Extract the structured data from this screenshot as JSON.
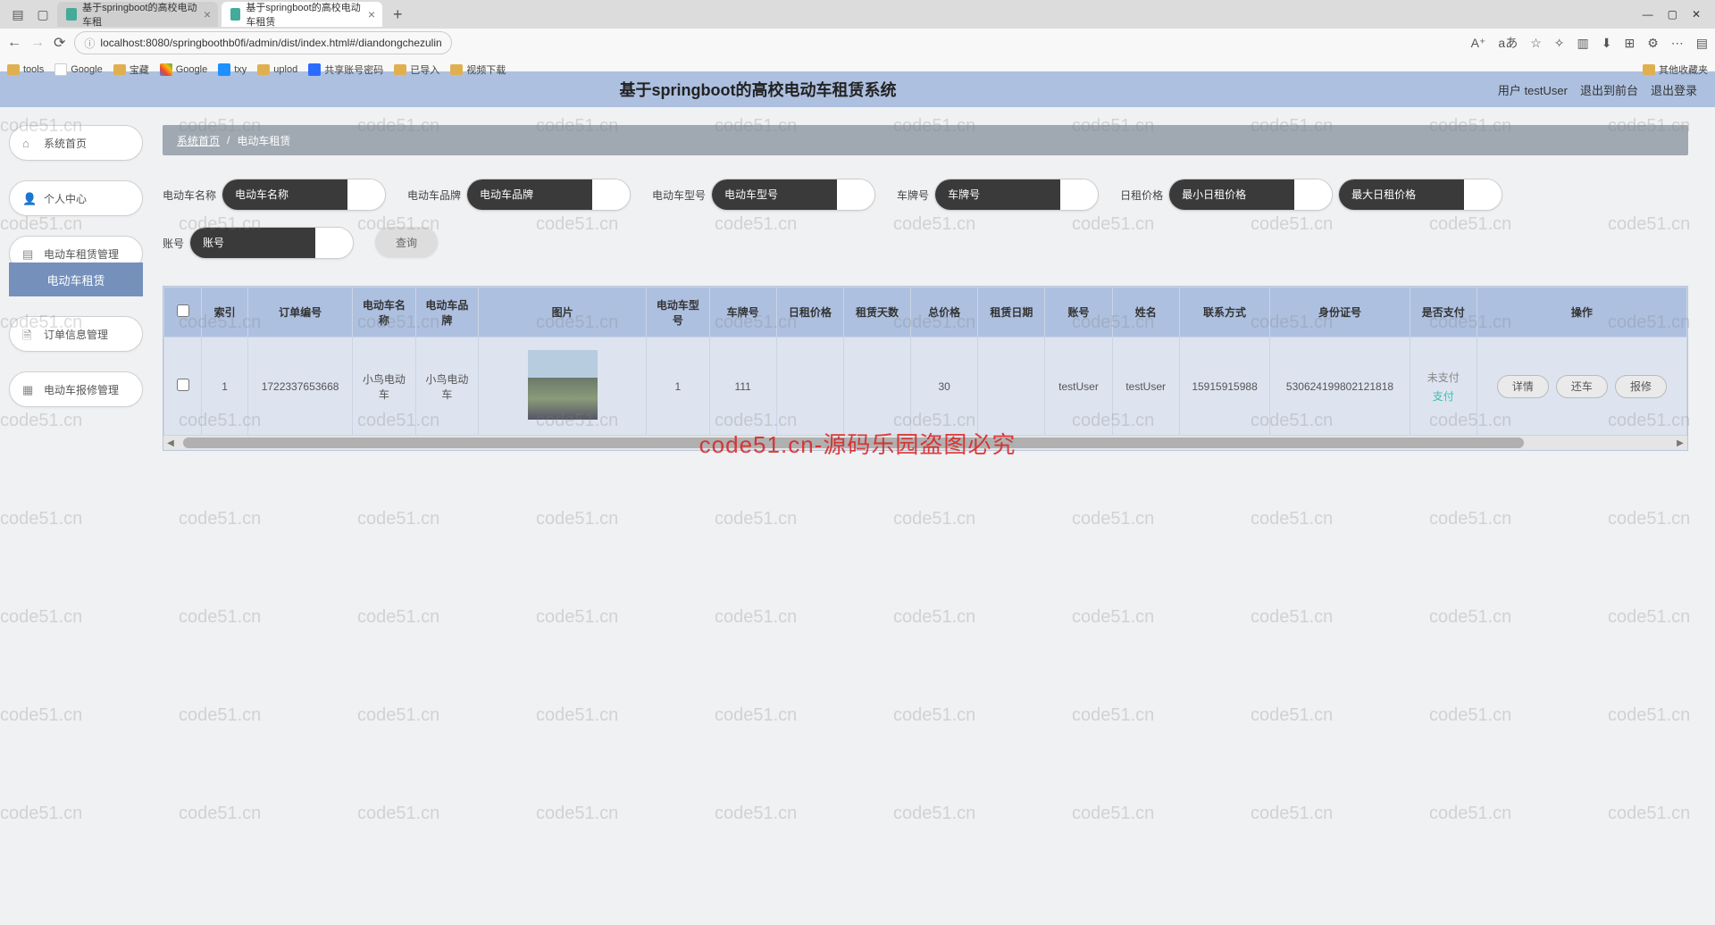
{
  "browser": {
    "tabs": [
      {
        "title": "基于springboot的高校电动车租",
        "active": false
      },
      {
        "title": "基于springboot的高校电动车租赁",
        "active": true
      }
    ],
    "url": "localhost:8080/springboothb0fi/admin/dist/index.html#/diandongchezulin",
    "bookmarks": [
      "tools",
      "Google",
      "宝藏",
      "Google",
      "txy",
      "uplod",
      "共享账号密码",
      "已导入",
      "视频下载"
    ],
    "other_bookmarks": "其他收藏夹"
  },
  "header": {
    "title": "基于springboot的高校电动车租赁系统",
    "user_label": "用户",
    "username": "testUser",
    "to_front": "退出到前台",
    "logout": "退出登录"
  },
  "sidebar": {
    "items": [
      {
        "label": "系统首页",
        "icon": "home"
      },
      {
        "label": "个人中心",
        "icon": "user"
      },
      {
        "label": "电动车租赁管理",
        "icon": "list",
        "sub": "电动车租赁"
      },
      {
        "label": "订单信息管理",
        "icon": "doc"
      },
      {
        "label": "电动车报修管理",
        "icon": "grid"
      }
    ]
  },
  "breadcrumb": {
    "home": "系统首页",
    "sep": "/",
    "current": "电动车租赁"
  },
  "filters": {
    "name_label": "电动车名称",
    "name_ph": "电动车名称",
    "brand_label": "电动车品牌",
    "brand_ph": "电动车品牌",
    "model_label": "电动车型号",
    "model_ph": "电动车型号",
    "plate_label": "车牌号",
    "plate_ph": "车牌号",
    "dayprice_label": "日租价格",
    "min_ph": "最小日租价格",
    "max_ph": "最大日租价格",
    "acct_label": "账号",
    "acct_ph": "账号",
    "query": "查询"
  },
  "table": {
    "headers": [
      "索引",
      "订单编号",
      "电动车名称",
      "电动车品牌",
      "图片",
      "电动车型号",
      "车牌号",
      "日租价格",
      "租赁天数",
      "总价格",
      "租赁日期",
      "账号",
      "姓名",
      "联系方式",
      "身份证号",
      "是否支付",
      "操作"
    ],
    "rows": [
      {
        "idx": "1",
        "order_no": "1722337653668",
        "name": "小鸟电动车",
        "brand": "小鸟电动车",
        "model": "1",
        "plate": "111",
        "day_price": "",
        "days": "",
        "total": "30",
        "date": "",
        "account": "testUser",
        "uname": "testUser",
        "contact": "15915915988",
        "id_no": "530624199802121818",
        "pay_status": "未支付",
        "pay_action": "支付",
        "ops": {
          "detail": "详情",
          "return": "还车",
          "repair": "报修"
        }
      }
    ]
  },
  "watermark": {
    "text": "code51.cn",
    "big": "code51.cn-源码乐园盗图必究"
  }
}
